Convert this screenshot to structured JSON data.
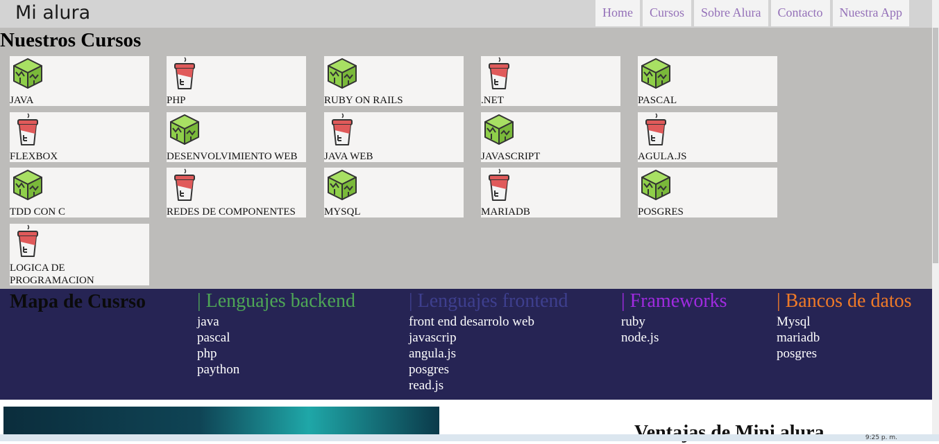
{
  "header": {
    "logo": "Mi alura",
    "nav": [
      "Home",
      "Cursos",
      "Sobre Alura",
      "Contacto",
      "Nuestra App"
    ]
  },
  "courses": {
    "title": "Nuestros Cursos",
    "items": [
      {
        "label": "JAVA",
        "icon": "cube-icon"
      },
      {
        "label": "PHP",
        "icon": "cup-icon"
      },
      {
        "label": "RUBY ON RAILS",
        "icon": "cube-icon"
      },
      {
        "label": ".NET",
        "icon": "cup-icon"
      },
      {
        "label": "PASCAL",
        "icon": "cube-icon"
      },
      {
        "label": "FLEXBOX",
        "icon": "cup-icon"
      },
      {
        "label": "DESENVOLVIMIENTO WEB",
        "icon": "cube-icon"
      },
      {
        "label": "JAVA WEB",
        "icon": "cup-icon"
      },
      {
        "label": "JAVASCRIPT",
        "icon": "cube-icon"
      },
      {
        "label": "AGULA.JS",
        "icon": "cup-icon"
      },
      {
        "label": "TDD CON C",
        "icon": "cube-icon"
      },
      {
        "label": "REDES DE COMPONENTES",
        "icon": "cup-icon"
      },
      {
        "label": "MYSQL",
        "icon": "cube-icon"
      },
      {
        "label": "MARIADB",
        "icon": "cup-icon"
      },
      {
        "label": "POSGRES",
        "icon": "cube-icon"
      },
      {
        "label": "LOGICA DE PROGRAMACION",
        "icon": "cup-icon"
      }
    ]
  },
  "map": {
    "title": "Mapa de Cusrso",
    "columns": [
      {
        "title": "| Lenguajes backend",
        "color": "#4ea656",
        "items": [
          "java",
          "pascal",
          "php",
          "paython"
        ]
      },
      {
        "title": "| Lenguajes frontend",
        "color": "#3e3f8e",
        "items": [
          "front end desarrolo web",
          "javascrip",
          "angula.js",
          "posgres",
          "read.js"
        ]
      },
      {
        "title": "| Frameworks",
        "color": "#a02be0",
        "items": [
          "ruby",
          "node.js"
        ]
      },
      {
        "title": "| Bancos de datos",
        "color": "#ef7a28",
        "items": [
          "Mysql",
          "mariadb",
          "posgres"
        ]
      }
    ]
  },
  "bottom": {
    "advantages_title": "Ventajas de Mini alura"
  },
  "taskbar": {
    "clock": "9:25 p. m."
  }
}
